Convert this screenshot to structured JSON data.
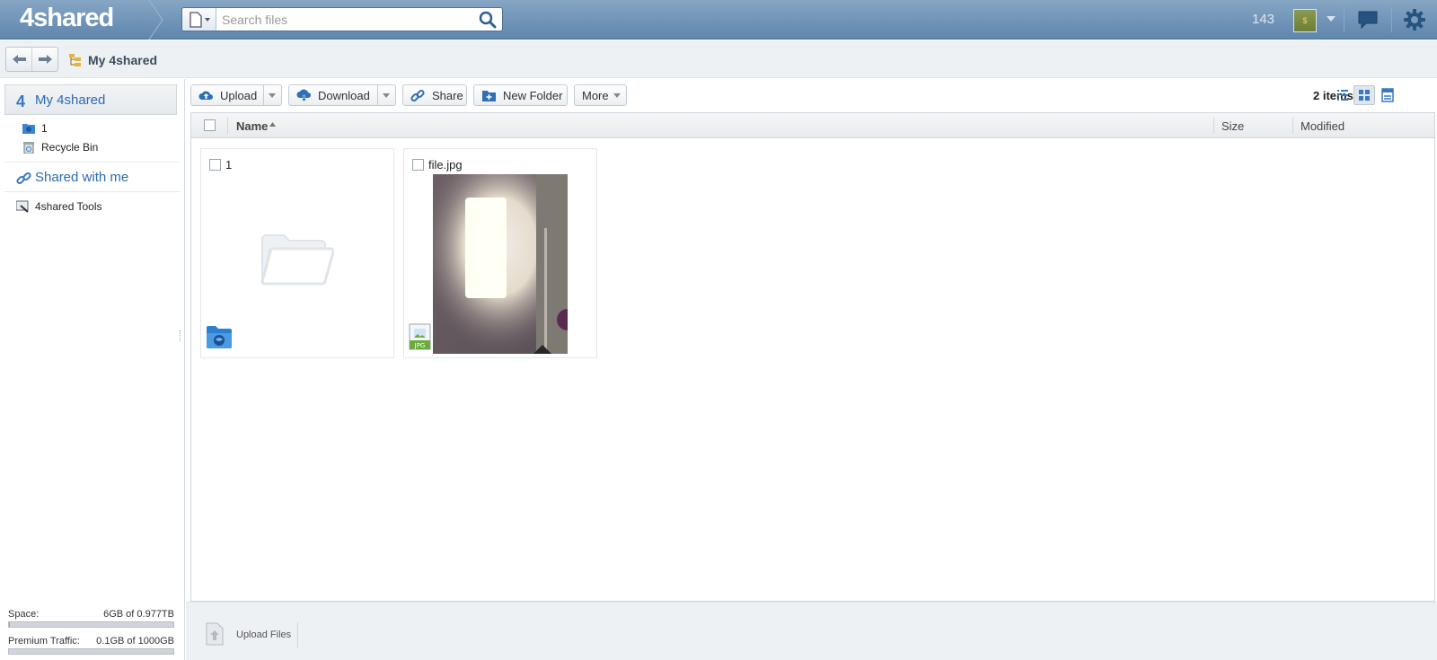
{
  "header": {
    "logo": "4shared",
    "search_placeholder": "Search files",
    "counter": "143",
    "avatar_initial": "$"
  },
  "breadcrumb": {
    "current": "My 4shared"
  },
  "sidebar": {
    "my_label": "My 4shared",
    "items": [
      {
        "label": "1",
        "icon": "shared-folder-icon"
      },
      {
        "label": "Recycle Bin",
        "icon": "recycle-bin-icon"
      }
    ],
    "shared_label": "Shared with me",
    "tools_label": "4shared Tools",
    "quota": {
      "space_label": "Space:",
      "space_value": "6GB of 0.977TB",
      "space_fraction": 0.006,
      "traffic_label": "Premium Traffic:",
      "traffic_value": "0.1GB of 1000GB",
      "traffic_fraction": 0.0001
    }
  },
  "toolbar": {
    "upload": "Upload",
    "download": "Download",
    "share": "Share",
    "new_folder": "New Folder",
    "more": "More",
    "items_count": "2 items"
  },
  "columns": {
    "name": "Name",
    "size": "Size",
    "modified": "Modified"
  },
  "files": [
    {
      "name": "1",
      "type": "folder"
    },
    {
      "name": "file.jpg",
      "type": "jpg",
      "badge": "JPG"
    }
  ],
  "bottom": {
    "upload_files": "Upload Files"
  },
  "colors": {
    "header_bg": "#6f93b8",
    "accent": "#2b6bb0",
    "toolbar_bg": "#eef1f4"
  }
}
